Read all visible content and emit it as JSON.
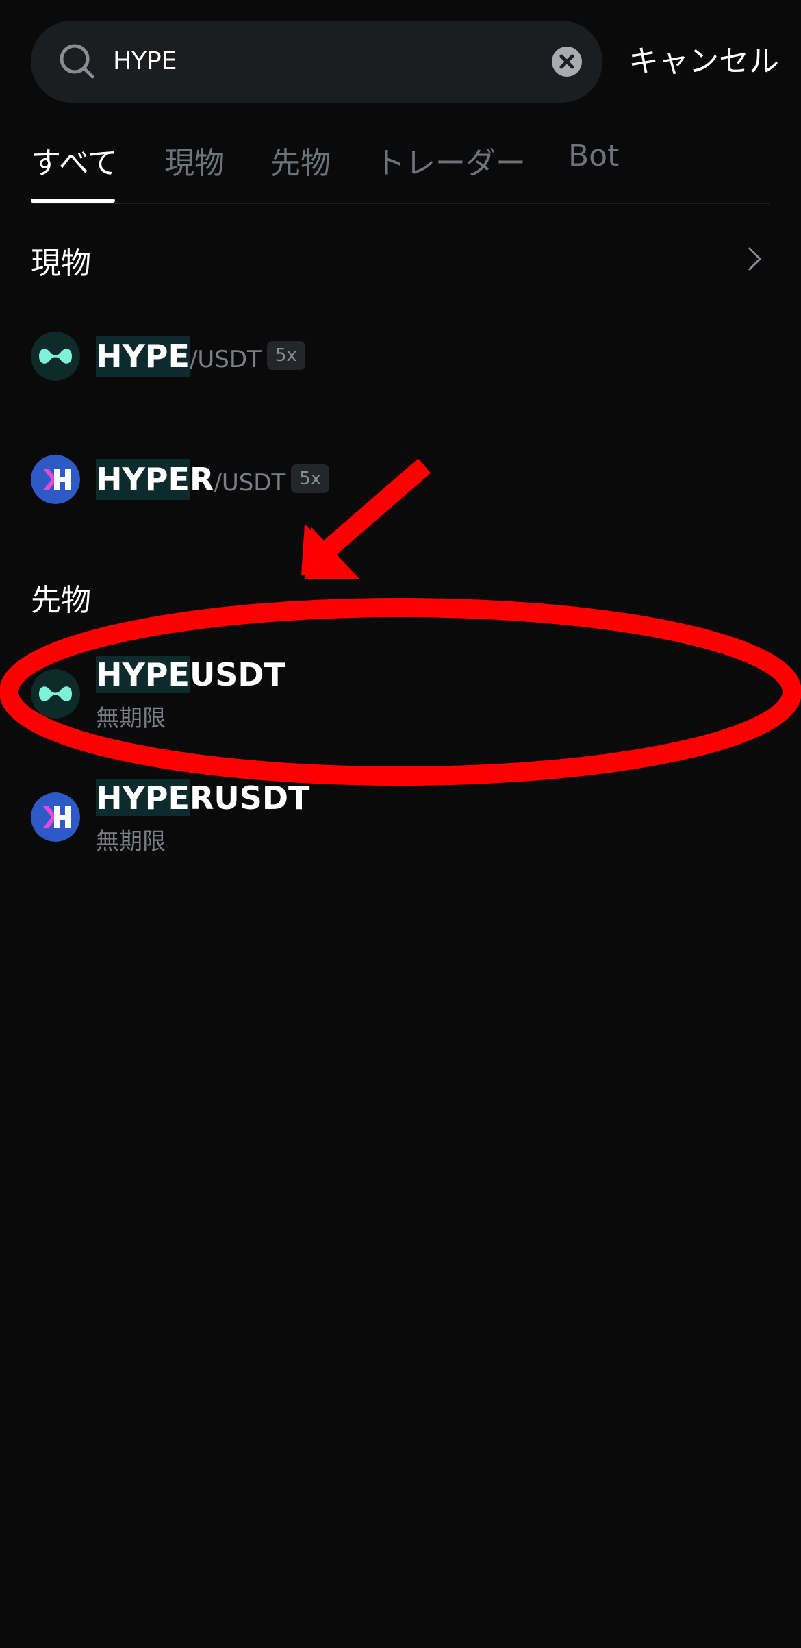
{
  "search": {
    "value": "HYPE"
  },
  "cancel_label": "キャンセル",
  "tabs": [
    {
      "label": "すべて",
      "active": true
    },
    {
      "label": "現物",
      "active": false
    },
    {
      "label": "先物",
      "active": false
    },
    {
      "label": "トレーダー",
      "active": false
    },
    {
      "label": "Bot",
      "active": false
    }
  ],
  "spot": {
    "title": "現物",
    "items": [
      {
        "match": "HYPE",
        "rest": "",
        "quote": "/USDT",
        "leverage": "5x",
        "icon": "hype-logo-icon"
      },
      {
        "match": "HYPE",
        "rest": "R",
        "quote": "/USDT",
        "leverage": "5x",
        "icon": "hyper-logo-icon"
      }
    ]
  },
  "futures": {
    "title": "先物",
    "items": [
      {
        "match": "HYPE",
        "rest": "USDT",
        "subtitle": "無期限",
        "icon": "hype-logo-icon"
      },
      {
        "match": "HYPE",
        "rest": "RUSDT",
        "subtitle": "無期限",
        "icon": "hyper-logo-icon"
      }
    ]
  },
  "colors": {
    "background": "#0a0a0a",
    "highlight": "#0d2a2d",
    "hype_logo": "#7ef2d6",
    "hyper_logo": "#2e5ac8",
    "annotation": "#ff0000"
  }
}
